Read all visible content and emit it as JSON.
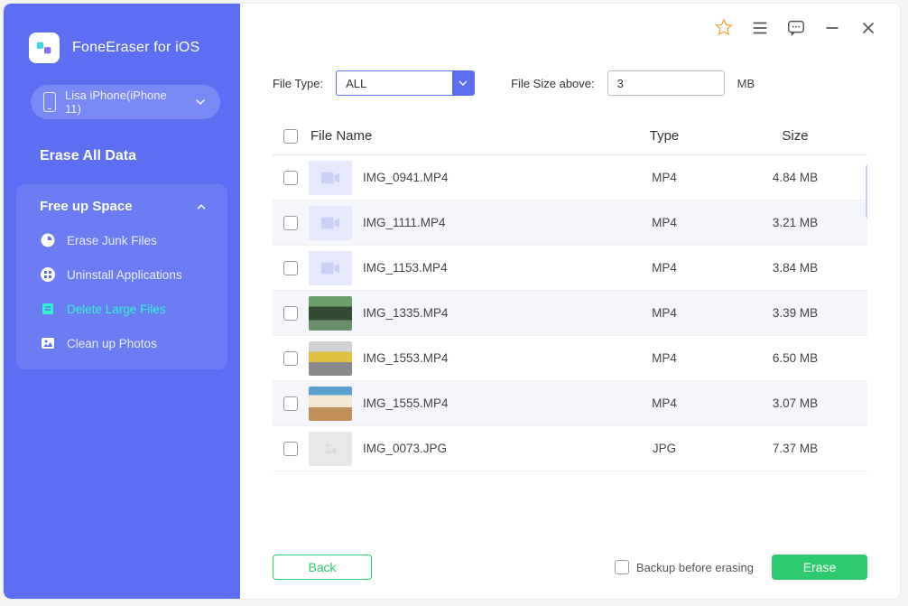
{
  "app": {
    "title": "FoneEraser for iOS"
  },
  "device": {
    "label": "Lisa iPhone(iPhone 11)"
  },
  "nav": {
    "erase_all": "Erase All Data",
    "free_up": "Free up Space",
    "items": [
      {
        "label": "Erase Junk Files"
      },
      {
        "label": "Uninstall Applications"
      },
      {
        "label": "Delete Large Files"
      },
      {
        "label": "Clean up Photos"
      }
    ]
  },
  "filters": {
    "file_type_label": "File Type:",
    "file_type_value": "ALL",
    "size_above_label": "File Size above:",
    "size_above_value": "3",
    "size_unit": "MB"
  },
  "table": {
    "headers": {
      "name": "File Name",
      "type": "Type",
      "size": "Size"
    },
    "rows": [
      {
        "name": "IMG_0941.MP4",
        "type": "MP4",
        "size": "4.84 MB",
        "thumb": "video"
      },
      {
        "name": "IMG_1111.MP4",
        "type": "MP4",
        "size": "3.21 MB",
        "thumb": "video"
      },
      {
        "name": "IMG_1153.MP4",
        "type": "MP4",
        "size": "3.84 MB",
        "thumb": "video"
      },
      {
        "name": "IMG_1335.MP4",
        "type": "MP4",
        "size": "3.39 MB",
        "thumb": "photo1"
      },
      {
        "name": "IMG_1553.MP4",
        "type": "MP4",
        "size": "6.50 MB",
        "thumb": "photo2"
      },
      {
        "name": "IMG_1555.MP4",
        "type": "MP4",
        "size": "3.07 MB",
        "thumb": "photo3"
      },
      {
        "name": "IMG_0073.JPG",
        "type": "JPG",
        "size": "7.37 MB",
        "thumb": "jpg"
      }
    ]
  },
  "footer": {
    "back": "Back",
    "backup_label": "Backup before erasing",
    "erase": "Erase"
  }
}
